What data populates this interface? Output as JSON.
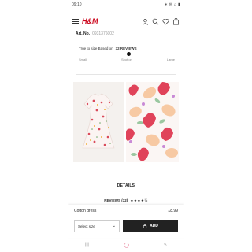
{
  "status": {
    "time": "09:10",
    "icons_right": "∗ ✉ ⌂ ▮"
  },
  "header": {
    "logo": "H&M",
    "icons": [
      "profile-icon",
      "search-icon",
      "heart-icon",
      "bag-icon"
    ]
  },
  "article": {
    "label": "Art. No.",
    "value": "0931376002"
  },
  "fit": {
    "title": "True to size Based on",
    "count": "32 REVIEWS",
    "labels": [
      "Small",
      "Spot on",
      "Large"
    ],
    "position": 0.52
  },
  "section": {
    "details": "DETAILS",
    "reviews": "REVIEWS (32)",
    "stars": "★★★★½"
  },
  "product": {
    "name": "Cotton dress",
    "price": "£8.99"
  },
  "size": {
    "placeholder": "Select size"
  },
  "add": {
    "label": "ADD"
  },
  "nav": {
    "recent": "|||",
    "home": "◯",
    "back": "<"
  },
  "colors": {
    "brand": "#cc071e",
    "button": "#222222"
  }
}
